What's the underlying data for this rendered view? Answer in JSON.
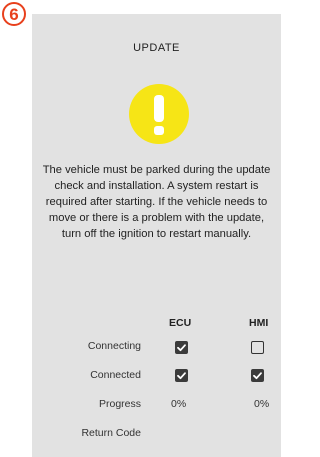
{
  "step_badge": "6",
  "dialog": {
    "title": "UPDATE",
    "warning_icon": "exclamation-icon",
    "message": "The vehicle must be parked during the update check and installation. A system restart is required after starting. If the vehicle needs to move or there is a problem with the update, turn off the ignition to restart manually."
  },
  "status_table": {
    "columns": [
      "ECU",
      "HMI"
    ],
    "rows": {
      "connecting": {
        "label": "Connecting",
        "ecu_checked": true,
        "hmi_checked": false
      },
      "connected": {
        "label": "Connected",
        "ecu_checked": true,
        "hmi_checked": true
      },
      "progress": {
        "label": "Progress",
        "ecu": "0%",
        "hmi": "0%"
      },
      "return_code": {
        "label": "Return Code",
        "ecu": "",
        "hmi": ""
      }
    }
  },
  "colors": {
    "badge": "#e8401c",
    "panel": "#e2e2e2",
    "warning": "#f6e516",
    "checkbox": "#3b3b3b"
  }
}
